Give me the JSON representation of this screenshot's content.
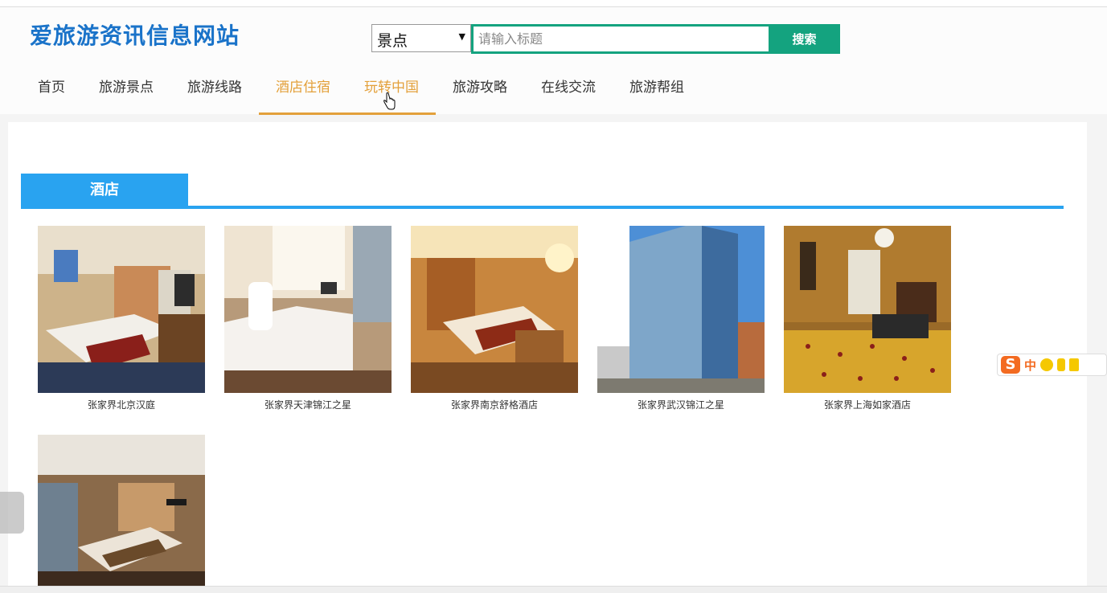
{
  "site": {
    "title": "爱旅游资讯信息网站"
  },
  "search": {
    "category": "景点",
    "placeholder": "请输入标题",
    "button_label": "搜索"
  },
  "nav": {
    "items": [
      {
        "label": "首页"
      },
      {
        "label": "旅游景点"
      },
      {
        "label": "旅游线路"
      },
      {
        "label": "酒店住宿"
      },
      {
        "label": "玩转中国"
      },
      {
        "label": "旅游攻略"
      },
      {
        "label": "在线交流"
      },
      {
        "label": "旅游帮组"
      }
    ]
  },
  "section": {
    "title": "酒店"
  },
  "hotels": [
    {
      "name": "张家界北京汉庭",
      "image": "hotel-room-photo"
    },
    {
      "name": "张家界天津锦江之星",
      "image": "hotel-room-photo"
    },
    {
      "name": "张家界南京舒格酒店",
      "image": "hotel-room-photo"
    },
    {
      "name": "张家界武汉锦江之星",
      "image": "hotel-building-photo"
    },
    {
      "name": "张家界上海如家酒店",
      "image": "hotel-room-photo"
    },
    {
      "name": "",
      "image": "hotel-room-photo"
    }
  ],
  "ime": {
    "logo": "S",
    "mode": "中"
  },
  "colors": {
    "brand": "#1a73c9",
    "search_accent": "#14a37f",
    "nav_active": "#e3a03a",
    "section_accent": "#29a3f0"
  }
}
